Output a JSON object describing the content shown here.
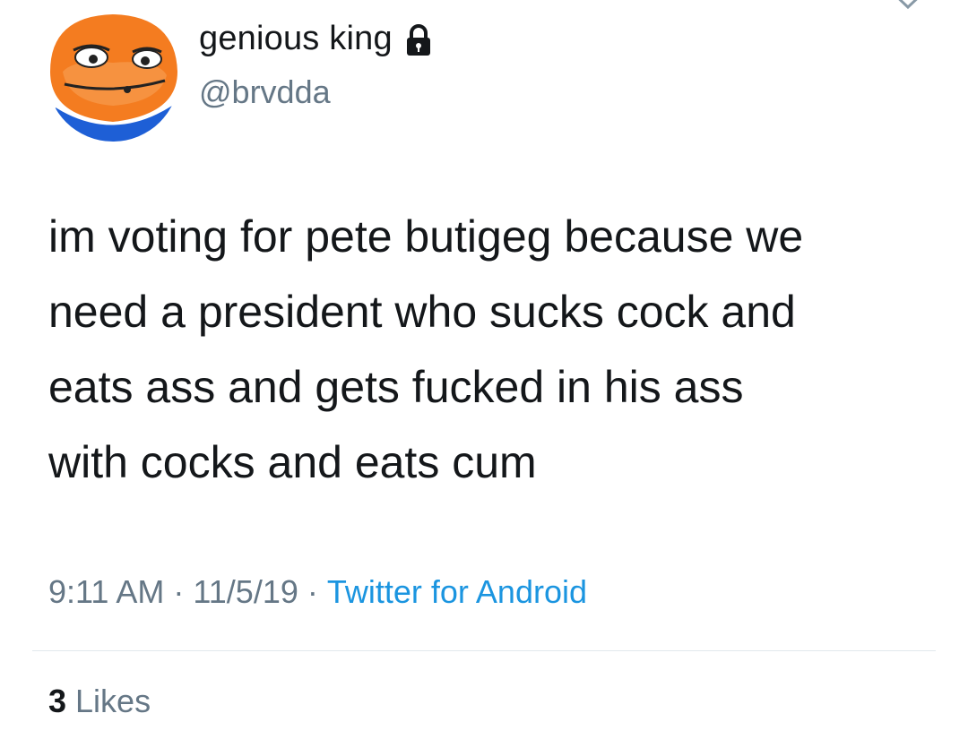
{
  "author": {
    "display_name": "genious king",
    "handle": "@brvdda",
    "protected_icon": "lock-icon",
    "avatar_icon": "cartoon-frog-avatar"
  },
  "tweet": {
    "text": "im voting for pete butigeg because we\nneed a president who sucks cock and\neats ass and gets fucked in his ass\nwith cocks and eats cum"
  },
  "meta": {
    "time": "9:11 AM",
    "separator": "·",
    "date": "11/5/19",
    "source": "Twitter for Android"
  },
  "stats": {
    "likes_count": "3",
    "likes_label": "Likes"
  },
  "colors": {
    "text": "#14171a",
    "secondary": "#657786",
    "link": "#1b95e0",
    "avatar_orange": "#f47c20",
    "avatar_blue": "#1e5fd6"
  }
}
